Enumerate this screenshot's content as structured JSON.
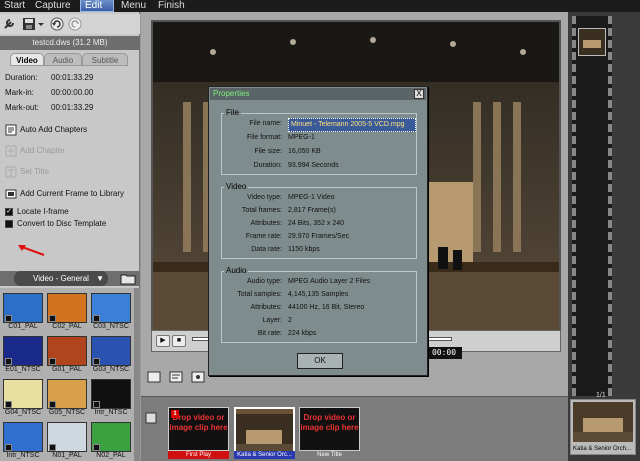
{
  "top_tabs": [
    "Start",
    "Capture",
    "Edit",
    "Menu",
    "Finish"
  ],
  "left_panel": {
    "file_label": "testcd.dws (31.2 MB)",
    "sub_tabs": [
      "Video",
      "Audio",
      "Subtitle"
    ],
    "info": [
      {
        "label": "Duration:",
        "value": "00:01:33.29"
      },
      {
        "label": "Mark-in:",
        "value": "00:00:00.00"
      },
      {
        "label": "Mark-out:",
        "value": "00:01:33.29"
      }
    ],
    "actions": [
      {
        "label": "Auto Add Chapters",
        "enabled": true
      },
      {
        "label": "Add Chapter",
        "enabled": false
      },
      {
        "label": "Set Title",
        "enabled": false
      },
      {
        "label": "Add Current Frame to Library",
        "enabled": true
      }
    ],
    "checks": [
      {
        "label": "Locate I-frame",
        "checked": true
      },
      {
        "label": "Convert to Disc Template",
        "checked": false
      }
    ],
    "category": "Video - General",
    "thumbnails": [
      {
        "label": "C01_PAL",
        "color": "#2b6fc9"
      },
      {
        "label": "C02_PAL",
        "color": "#d2741e"
      },
      {
        "label": "C03_NTSC",
        "color": "#3a7fd8"
      },
      {
        "label": "E01_NTSC",
        "color": "#1a2a8a"
      },
      {
        "label": "G01_PAL",
        "color": "#b0441c"
      },
      {
        "label": "G03_NTSC",
        "color": "#2a52b0"
      },
      {
        "label": "G04_NTSC",
        "color": "#e8dfa0"
      },
      {
        "label": "G05_NTSC",
        "color": "#d8a048"
      },
      {
        "label": "Intr_NTSC",
        "color": "#101010"
      },
      {
        "label": "Intr_NTSC",
        "color": "#2f6fd0"
      },
      {
        "label": "N01_PAL",
        "color": "#cfd8e0"
      },
      {
        "label": "N02_PAL",
        "color": "#3aa040"
      }
    ]
  },
  "player": {
    "timecode": "00:00"
  },
  "storyline": {
    "slots": [
      {
        "text": "Drop video or image clip here",
        "label": "First Play",
        "number": "1",
        "type": "empty",
        "label_bg": "#d01010"
      },
      {
        "text": "",
        "label": "Katia & Senior Orc...",
        "number": "",
        "type": "clip",
        "label_bg": "#2a3ab0"
      },
      {
        "text": "Drop video or image clip here",
        "label": "New Title",
        "number": "",
        "type": "empty",
        "label_bg": "transparent"
      }
    ]
  },
  "right_panel": {
    "page_counter": "1/1",
    "thumb_caption": "Katia & Senior Orch..."
  },
  "dialog": {
    "title": "Properties",
    "close_glyph": "X",
    "groups": [
      {
        "title": "File",
        "rows": [
          {
            "key": "File name:",
            "value": "Minuet - Telemann 2005-5 VCD.mpg"
          },
          {
            "key": "File format:",
            "value": "MPEG-1"
          },
          {
            "key": "File size:",
            "value": "16,050 KB"
          },
          {
            "key": "Duration:",
            "value": "93.994 Seconds"
          }
        ]
      },
      {
        "title": "Video",
        "rows": [
          {
            "key": "Video type:",
            "value": "MPEG-1 Video"
          },
          {
            "key": "Total frames:",
            "value": "2,817 Frame(s)"
          },
          {
            "key": "Attributes:",
            "value": "24 Bits, 352 x 240"
          },
          {
            "key": "Frame rate:",
            "value": "29.970 Frames/Sec"
          },
          {
            "key": "Data rate:",
            "value": "1150 kbps"
          }
        ]
      },
      {
        "title": "Audio",
        "rows": [
          {
            "key": "Audio type:",
            "value": "MPEG Audio Layer 2 Files"
          },
          {
            "key": "Total samples:",
            "value": "4,145,135 Samples"
          },
          {
            "key": "Attributes:",
            "value": "44100 Hz, 16 Bit, Stereo"
          },
          {
            "key": "Layer:",
            "value": "2"
          },
          {
            "key": "Bit rate:",
            "value": "224 kbps"
          }
        ]
      }
    ],
    "ok_label": "OK"
  }
}
